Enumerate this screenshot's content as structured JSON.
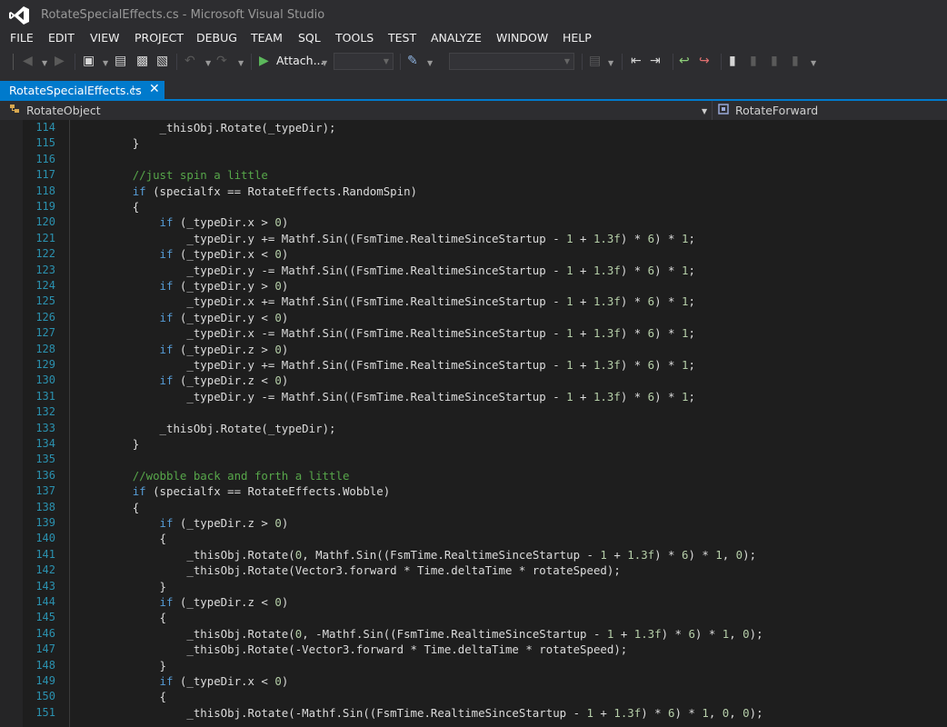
{
  "window": {
    "title": "RotateSpecialEffects.cs - Microsoft Visual Studio"
  },
  "menu": [
    "FILE",
    "EDIT",
    "VIEW",
    "PROJECT",
    "DEBUG",
    "TEAM",
    "SQL",
    "TOOLS",
    "TEST",
    "ANALYZE",
    "WINDOW",
    "HELP"
  ],
  "toolbar": {
    "attach_label": "Attach...",
    "icons": [
      "navigate-back-icon",
      "navigate-forward-icon",
      "new-project-icon",
      "open-file-icon",
      "save-icon",
      "save-all-icon",
      "undo-icon",
      "redo-icon",
      "start-debugging-icon",
      "breakpoint-window-icon",
      "comment-icon",
      "uncomment-icon",
      "bookmark-icon",
      "prev-bookmark-icon",
      "next-bookmark-icon",
      "clear-bookmarks-icon"
    ]
  },
  "tab": {
    "label": "RotateSpecialEffects.cs"
  },
  "nav": {
    "left_label": "RotateObject",
    "right_label": "RotateForward"
  },
  "colors": {
    "accent": "#007acc",
    "keyword": "#569cd6",
    "comment": "#57a64a",
    "number": "#b5cea8",
    "line_number": "#2b91af",
    "background": "#1e1e1e"
  },
  "code": [
    {
      "n": "114",
      "i": "            ",
      "t": [
        [
          "p",
          "_thisObj.Rotate(_typeDir);"
        ]
      ]
    },
    {
      "n": "115",
      "i": "        ",
      "t": [
        [
          "p",
          "}"
        ]
      ]
    },
    {
      "n": "116",
      "i": "",
      "t": []
    },
    {
      "n": "117",
      "i": "        ",
      "t": [
        [
          "c",
          "//just spin a little"
        ]
      ]
    },
    {
      "n": "118",
      "i": "        ",
      "t": [
        [
          "k",
          "if"
        ],
        [
          "p",
          " (specialfx == RotateEffects.RandomSpin)"
        ]
      ]
    },
    {
      "n": "119",
      "i": "        ",
      "t": [
        [
          "p",
          "{"
        ]
      ]
    },
    {
      "n": "120",
      "i": "            ",
      "t": [
        [
          "k",
          "if"
        ],
        [
          "p",
          " (_typeDir.x > "
        ],
        [
          "n",
          "0"
        ],
        [
          "p",
          ")"
        ]
      ]
    },
    {
      "n": "121",
      "i": "                ",
      "t": [
        [
          "p",
          "_typeDir.y += Mathf.Sin((FsmTime.RealtimeSinceStartup - "
        ],
        [
          "n",
          "1"
        ],
        [
          "p",
          " + "
        ],
        [
          "n",
          "1.3f"
        ],
        [
          "p",
          ") * "
        ],
        [
          "n",
          "6"
        ],
        [
          "p",
          ") * "
        ],
        [
          "n",
          "1"
        ],
        [
          "p",
          ";"
        ]
      ]
    },
    {
      "n": "122",
      "i": "            ",
      "t": [
        [
          "k",
          "if"
        ],
        [
          "p",
          " (_typeDir.x < "
        ],
        [
          "n",
          "0"
        ],
        [
          "p",
          ")"
        ]
      ]
    },
    {
      "n": "123",
      "i": "                ",
      "t": [
        [
          "p",
          "_typeDir.y -= Mathf.Sin((FsmTime.RealtimeSinceStartup - "
        ],
        [
          "n",
          "1"
        ],
        [
          "p",
          " + "
        ],
        [
          "n",
          "1.3f"
        ],
        [
          "p",
          ") * "
        ],
        [
          "n",
          "6"
        ],
        [
          "p",
          ") * "
        ],
        [
          "n",
          "1"
        ],
        [
          "p",
          ";"
        ]
      ]
    },
    {
      "n": "124",
      "i": "            ",
      "t": [
        [
          "k",
          "if"
        ],
        [
          "p",
          " (_typeDir.y > "
        ],
        [
          "n",
          "0"
        ],
        [
          "p",
          ")"
        ]
      ]
    },
    {
      "n": "125",
      "i": "                ",
      "t": [
        [
          "p",
          "_typeDir.x += Mathf.Sin((FsmTime.RealtimeSinceStartup - "
        ],
        [
          "n",
          "1"
        ],
        [
          "p",
          " + "
        ],
        [
          "n",
          "1.3f"
        ],
        [
          "p",
          ") * "
        ],
        [
          "n",
          "6"
        ],
        [
          "p",
          ") * "
        ],
        [
          "n",
          "1"
        ],
        [
          "p",
          ";"
        ]
      ]
    },
    {
      "n": "126",
      "i": "            ",
      "t": [
        [
          "k",
          "if"
        ],
        [
          "p",
          " (_typeDir.y < "
        ],
        [
          "n",
          "0"
        ],
        [
          "p",
          ")"
        ]
      ]
    },
    {
      "n": "127",
      "i": "                ",
      "t": [
        [
          "p",
          "_typeDir.x -= Mathf.Sin((FsmTime.RealtimeSinceStartup - "
        ],
        [
          "n",
          "1"
        ],
        [
          "p",
          " + "
        ],
        [
          "n",
          "1.3f"
        ],
        [
          "p",
          ") * "
        ],
        [
          "n",
          "6"
        ],
        [
          "p",
          ") * "
        ],
        [
          "n",
          "1"
        ],
        [
          "p",
          ";"
        ]
      ]
    },
    {
      "n": "128",
      "i": "            ",
      "t": [
        [
          "k",
          "if"
        ],
        [
          "p",
          " (_typeDir.z > "
        ],
        [
          "n",
          "0"
        ],
        [
          "p",
          ")"
        ]
      ]
    },
    {
      "n": "129",
      "i": "                ",
      "t": [
        [
          "p",
          "_typeDir.y += Mathf.Sin((FsmTime.RealtimeSinceStartup - "
        ],
        [
          "n",
          "1"
        ],
        [
          "p",
          " + "
        ],
        [
          "n",
          "1.3f"
        ],
        [
          "p",
          ") * "
        ],
        [
          "n",
          "6"
        ],
        [
          "p",
          ") * "
        ],
        [
          "n",
          "1"
        ],
        [
          "p",
          ";"
        ]
      ]
    },
    {
      "n": "130",
      "i": "            ",
      "t": [
        [
          "k",
          "if"
        ],
        [
          "p",
          " (_typeDir.z < "
        ],
        [
          "n",
          "0"
        ],
        [
          "p",
          ")"
        ]
      ]
    },
    {
      "n": "131",
      "i": "                ",
      "t": [
        [
          "p",
          "_typeDir.y -= Mathf.Sin((FsmTime.RealtimeSinceStartup - "
        ],
        [
          "n",
          "1"
        ],
        [
          "p",
          " + "
        ],
        [
          "n",
          "1.3f"
        ],
        [
          "p",
          ") * "
        ],
        [
          "n",
          "6"
        ],
        [
          "p",
          ") * "
        ],
        [
          "n",
          "1"
        ],
        [
          "p",
          ";"
        ]
      ]
    },
    {
      "n": "132",
      "i": "",
      "t": []
    },
    {
      "n": "133",
      "i": "            ",
      "t": [
        [
          "p",
          "_thisObj.Rotate(_typeDir);"
        ]
      ]
    },
    {
      "n": "134",
      "i": "        ",
      "t": [
        [
          "p",
          "}"
        ]
      ]
    },
    {
      "n": "135",
      "i": "",
      "t": []
    },
    {
      "n": "136",
      "i": "        ",
      "t": [
        [
          "c",
          "//wobble back and forth a little"
        ]
      ]
    },
    {
      "n": "137",
      "i": "        ",
      "t": [
        [
          "k",
          "if"
        ],
        [
          "p",
          " (specialfx == RotateEffects.Wobble)"
        ]
      ]
    },
    {
      "n": "138",
      "i": "        ",
      "t": [
        [
          "p",
          "{"
        ]
      ]
    },
    {
      "n": "139",
      "i": "            ",
      "t": [
        [
          "k",
          "if"
        ],
        [
          "p",
          " (_typeDir.z > "
        ],
        [
          "n",
          "0"
        ],
        [
          "p",
          ")"
        ]
      ]
    },
    {
      "n": "140",
      "i": "            ",
      "t": [
        [
          "p",
          "{"
        ]
      ]
    },
    {
      "n": "141",
      "i": "                ",
      "t": [
        [
          "p",
          "_thisObj.Rotate("
        ],
        [
          "n",
          "0"
        ],
        [
          "p",
          ", Mathf.Sin((FsmTime.RealtimeSinceStartup - "
        ],
        [
          "n",
          "1"
        ],
        [
          "p",
          " + "
        ],
        [
          "n",
          "1.3f"
        ],
        [
          "p",
          ") * "
        ],
        [
          "n",
          "6"
        ],
        [
          "p",
          ") * "
        ],
        [
          "n",
          "1"
        ],
        [
          "p",
          ", "
        ],
        [
          "n",
          "0"
        ],
        [
          "p",
          ");"
        ]
      ]
    },
    {
      "n": "142",
      "i": "                ",
      "t": [
        [
          "p",
          "_thisObj.Rotate(Vector3.forward * Time.deltaTime * rotateSpeed);"
        ]
      ]
    },
    {
      "n": "143",
      "i": "            ",
      "t": [
        [
          "p",
          "}"
        ]
      ]
    },
    {
      "n": "144",
      "i": "            ",
      "t": [
        [
          "k",
          "if"
        ],
        [
          "p",
          " (_typeDir.z < "
        ],
        [
          "n",
          "0"
        ],
        [
          "p",
          ")"
        ]
      ]
    },
    {
      "n": "145",
      "i": "            ",
      "t": [
        [
          "p",
          "{"
        ]
      ]
    },
    {
      "n": "146",
      "i": "                ",
      "t": [
        [
          "p",
          "_thisObj.Rotate("
        ],
        [
          "n",
          "0"
        ],
        [
          "p",
          ", -Mathf.Sin((FsmTime.RealtimeSinceStartup - "
        ],
        [
          "n",
          "1"
        ],
        [
          "p",
          " + "
        ],
        [
          "n",
          "1.3f"
        ],
        [
          "p",
          ") * "
        ],
        [
          "n",
          "6"
        ],
        [
          "p",
          ") * "
        ],
        [
          "n",
          "1"
        ],
        [
          "p",
          ", "
        ],
        [
          "n",
          "0"
        ],
        [
          "p",
          ");"
        ]
      ]
    },
    {
      "n": "147",
      "i": "                ",
      "t": [
        [
          "p",
          "_thisObj.Rotate(-Vector3.forward * Time.deltaTime * rotateSpeed);"
        ]
      ]
    },
    {
      "n": "148",
      "i": "            ",
      "t": [
        [
          "p",
          "}"
        ]
      ]
    },
    {
      "n": "149",
      "i": "            ",
      "t": [
        [
          "k",
          "if"
        ],
        [
          "p",
          " (_typeDir.x < "
        ],
        [
          "n",
          "0"
        ],
        [
          "p",
          ")"
        ]
      ]
    },
    {
      "n": "150",
      "i": "            ",
      "t": [
        [
          "p",
          "{"
        ]
      ]
    },
    {
      "n": "151",
      "i": "                ",
      "t": [
        [
          "p",
          "_thisObj.Rotate(-Mathf.Sin((FsmTime.RealtimeSinceStartup - "
        ],
        [
          "n",
          "1"
        ],
        [
          "p",
          " + "
        ],
        [
          "n",
          "1.3f"
        ],
        [
          "p",
          ") * "
        ],
        [
          "n",
          "6"
        ],
        [
          "p",
          ") * "
        ],
        [
          "n",
          "1"
        ],
        [
          "p",
          ", "
        ],
        [
          "n",
          "0"
        ],
        [
          "p",
          ", "
        ],
        [
          "n",
          "0"
        ],
        [
          "p",
          ");"
        ]
      ]
    }
  ]
}
